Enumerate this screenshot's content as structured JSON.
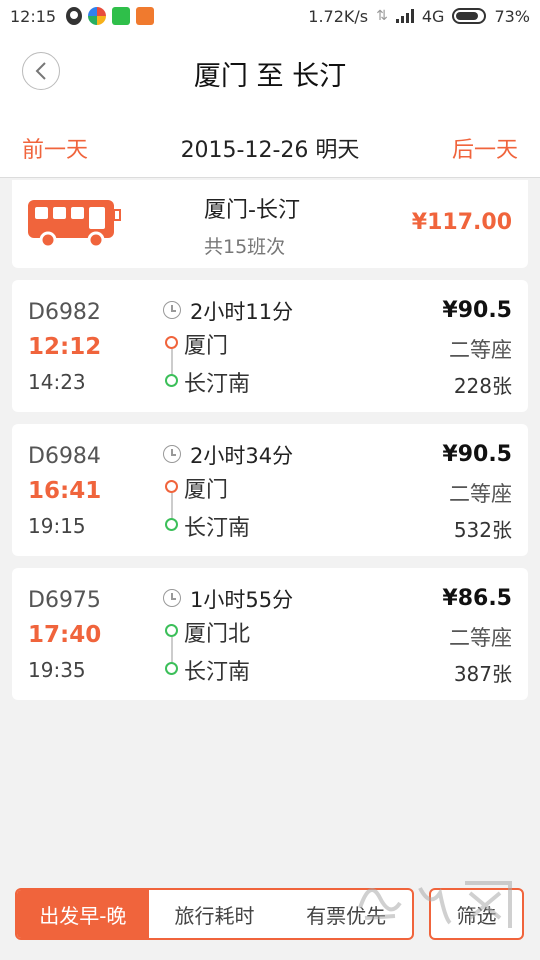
{
  "status_bar": {
    "time": "12:15",
    "network_speed": "1.72K/s",
    "network_type": "4G",
    "battery": "73%"
  },
  "header": {
    "title": "厦门 至 长汀",
    "back_icon": "chevron-left-icon"
  },
  "date_bar": {
    "prev_label": "前一天",
    "current": "2015-12-26 明天",
    "next_label": "后一天"
  },
  "bus": {
    "route": "厦门-长汀",
    "count": "共15班次",
    "price": "¥117.00",
    "icon": "bus-icon"
  },
  "trains": [
    {
      "number": "D6982",
      "departure": "12:12",
      "arrival": "14:23",
      "duration": "2小时11分",
      "from": "厦门",
      "to": "长汀南",
      "price": "¥90.5",
      "seat": "二等座",
      "tickets": "228张"
    },
    {
      "number": "D6984",
      "departure": "16:41",
      "arrival": "19:15",
      "duration": "2小时34分",
      "from": "厦门",
      "to": "长汀南",
      "price": "¥90.5",
      "seat": "二等座",
      "tickets": "532张"
    },
    {
      "number": "D6975",
      "departure": "17:40",
      "arrival": "19:35",
      "duration": "1小时55分",
      "from": "厦门北",
      "to": "长汀南",
      "price": "¥86.5",
      "seat": "二等座",
      "tickets": "387张"
    }
  ],
  "bottom_bar": {
    "sort_options": [
      "出发早-晚",
      "旅行耗时",
      "有票优先"
    ],
    "active_sort": "出发早-晚",
    "filter_label": "筛选"
  },
  "colors": {
    "accent": "#f0643c",
    "green": "#3cbf5a"
  }
}
